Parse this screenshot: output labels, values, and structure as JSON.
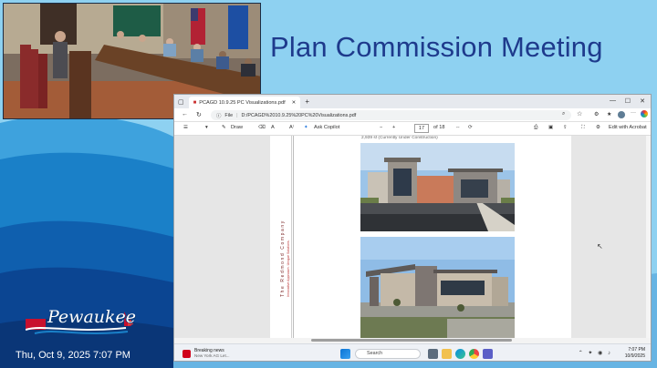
{
  "broadcast": {
    "title": "Plan Commission Meeting",
    "logo_text": "Pewaukee",
    "timestamp": "Thu, Oct 9, 2025 7:07 PM"
  },
  "browser": {
    "tab_title": "PCAGD 10.9.25 PC Visualizations.pdf",
    "new_tab": "+",
    "window_controls": [
      "—",
      "☐",
      "✕"
    ],
    "address_scheme": "File",
    "address_url": "D:/PCAGD%2010.9.25%20PC%20Visualizations.pdf"
  },
  "pdf_toolbar": {
    "draw_label": "Draw",
    "ask_copilot_label": "Ask Copilot",
    "zoom_out": "−",
    "zoom_in": "+",
    "current_page": "17",
    "page_total": "of 18",
    "edit_label": "Edit with Acrobat"
  },
  "document": {
    "caption": "2,939 sf (Currently Under Construction)",
    "vertical_logo": "The Redmond Company",
    "vertical_tagline": "Innovative Approach. Unique Solutions."
  },
  "taskbar": {
    "news_title": "Breaking news",
    "news_sub": "New York AG Let...",
    "search_placeholder": "Search",
    "clock_time": "7:07 PM",
    "clock_date": "10/9/2025"
  }
}
